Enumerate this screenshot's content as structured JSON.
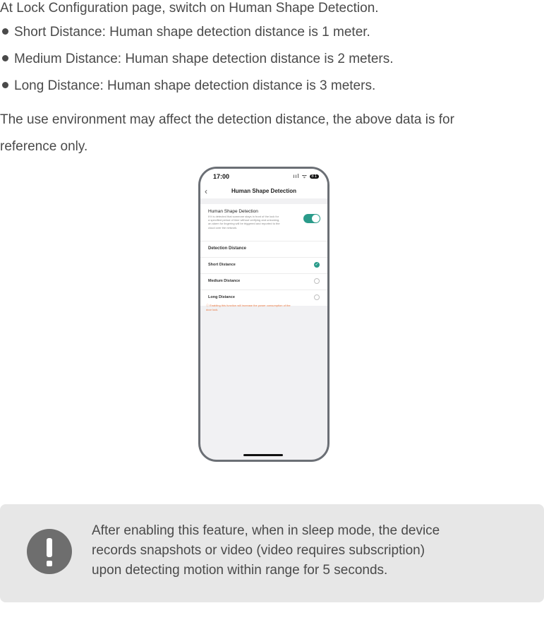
{
  "intro": {
    "lead": "At Lock Configuration page, switch on Human Shape Detection.",
    "bullets": [
      "Short Distance: Human shape detection distance is 1 meter.",
      "Medium Distance: Human shape detection distance is 2 meters.",
      "Long Distance: Human shape detection distance is 3 meters."
    ],
    "note_line1": "The use environment may affect the detection distance, the above data is for",
    "note_line2": "reference only."
  },
  "phone": {
    "time": "17:00",
    "status_icons": "ııl ᯤ",
    "battery": "81",
    "back_icon": "chevron-left-icon",
    "title": "Human Shape Detection",
    "setting_label": "Human Shape Detection",
    "setting_desc": "If it is detected that someone stays in front of the lock for\na specified period of time without verifying and unlocking,\nan alarm for lingering will be triggered and reported to the\ncloud over the network.",
    "toggle_on": true,
    "section": "Detection Distance",
    "options": [
      {
        "label": "Short Distance",
        "selected": true
      },
      {
        "label": "Medium Distance",
        "selected": false
      },
      {
        "label": "Long Distance",
        "selected": false
      }
    ],
    "warning": "ⓘ Enabling this function will increase the power consumption of the\n    door lock.",
    "accent": "#2a9b8a",
    "warning_color": "#e8743b"
  },
  "callout": {
    "icon": "exclamation-icon",
    "text": "After enabling this feature, when in sleep mode, the device\nrecords snapshots or video (video requires subscription)\nupon detecting motion within range for 5 seconds."
  }
}
